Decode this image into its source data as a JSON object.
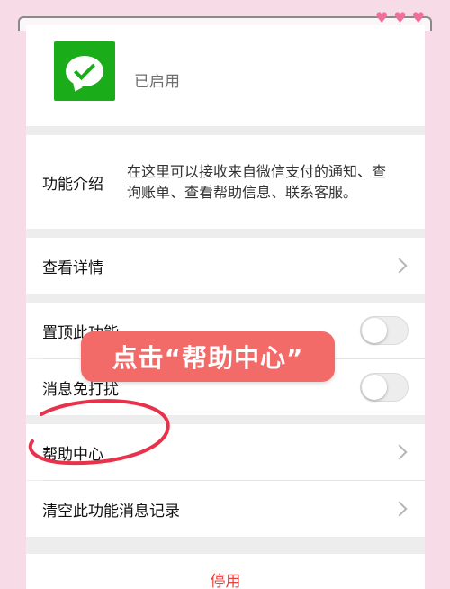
{
  "app": {
    "status": "已启用",
    "icon": "wechat-pay-icon",
    "brand_color": "#1aad19"
  },
  "intro": {
    "label": "功能介绍",
    "description": "在这里可以接收来自微信支付的通知、查询账单、查看帮助信息、联系客服。"
  },
  "rows": {
    "view_details": "查看详情",
    "pin_top": "置顶此功能",
    "mute": "消息免打扰",
    "help_center": "帮助中心",
    "clear_history": "清空此功能消息记录"
  },
  "toggles": {
    "pin_top_on": false,
    "mute_on": false
  },
  "footer": {
    "disable_label": "停用",
    "disable_color": "#e64340"
  },
  "annotation": {
    "pill_text": "点击“帮助中心”",
    "pill_color": "#f36b68",
    "circle_color": "#e8324b"
  },
  "decor": {
    "hearts": [
      "♥",
      "♥",
      "♥"
    ],
    "heart_color": "#f06f9a"
  }
}
